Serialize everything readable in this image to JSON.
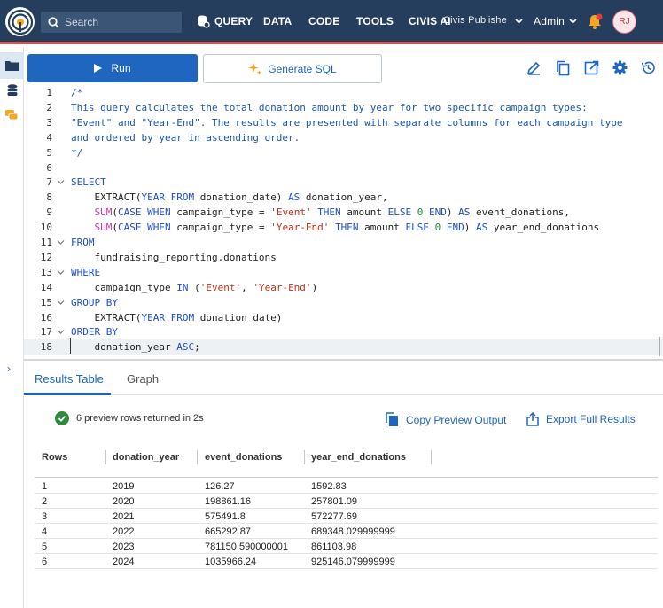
{
  "topbar": {
    "search_placeholder": "Search",
    "nav": [
      "QUERY",
      "DATA",
      "CODE",
      "TOOLS"
    ],
    "civis_ai": "CIVIS AI",
    "workspace": "Civis Publishe",
    "admin": "Admin",
    "avatar_initials": "RJ"
  },
  "toolbar": {
    "run_label": "Run",
    "generate_label": "Generate SQL"
  },
  "editor": {
    "lines": [
      {
        "n": "1",
        "fold": "",
        "tokens": [
          [
            "c-com",
            "/*"
          ]
        ]
      },
      {
        "n": "2",
        "fold": "",
        "tokens": [
          [
            "c-com",
            "This query calculates the total donation amount by year for two specific campaign types:"
          ]
        ]
      },
      {
        "n": "3",
        "fold": "",
        "tokens": [
          [
            "c-com",
            "\"Event\" and \"Year-End\". The results are presented with separate columns for each campaign type"
          ]
        ]
      },
      {
        "n": "4",
        "fold": "",
        "tokens": [
          [
            "c-com",
            "and ordered by year in ascending order."
          ]
        ]
      },
      {
        "n": "5",
        "fold": "",
        "tokens": [
          [
            "c-com",
            "*/"
          ]
        ]
      },
      {
        "n": "6",
        "fold": "",
        "tokens": []
      },
      {
        "n": "7",
        "fold": "v",
        "tokens": [
          [
            "c-kw",
            "SELECT"
          ]
        ]
      },
      {
        "n": "8",
        "fold": "",
        "tokens": [
          [
            "c-id",
            "    EXTRACT("
          ],
          [
            "c-kw",
            "YEAR FROM"
          ],
          [
            "c-id",
            " donation_date) "
          ],
          [
            "c-kw",
            "AS"
          ],
          [
            "c-id",
            " donation_year,"
          ]
        ]
      },
      {
        "n": "9",
        "fold": "",
        "tokens": [
          [
            "c-id",
            "    "
          ],
          [
            "c-fn",
            "SUM"
          ],
          [
            "c-id",
            "("
          ],
          [
            "c-kw",
            "CASE WHEN"
          ],
          [
            "c-id",
            " campaign_type = "
          ],
          [
            "c-str",
            "'Event'"
          ],
          [
            "c-id",
            " "
          ],
          [
            "c-kw",
            "THEN"
          ],
          [
            "c-id",
            " amount "
          ],
          [
            "c-kw",
            "ELSE"
          ],
          [
            "c-id",
            " "
          ],
          [
            "c-num",
            "0"
          ],
          [
            "c-id",
            " "
          ],
          [
            "c-kw",
            "END"
          ],
          [
            "c-id",
            ") "
          ],
          [
            "c-kw",
            "AS"
          ],
          [
            "c-id",
            " event_donations,"
          ]
        ]
      },
      {
        "n": "10",
        "fold": "",
        "tokens": [
          [
            "c-id",
            "    "
          ],
          [
            "c-fn",
            "SUM"
          ],
          [
            "c-id",
            "("
          ],
          [
            "c-kw",
            "CASE WHEN"
          ],
          [
            "c-id",
            " campaign_type = "
          ],
          [
            "c-str",
            "'Year-End'"
          ],
          [
            "c-id",
            " "
          ],
          [
            "c-kw",
            "THEN"
          ],
          [
            "c-id",
            " amount "
          ],
          [
            "c-kw",
            "ELSE"
          ],
          [
            "c-id",
            " "
          ],
          [
            "c-num",
            "0"
          ],
          [
            "c-id",
            " "
          ],
          [
            "c-kw",
            "END"
          ],
          [
            "c-id",
            ") "
          ],
          [
            "c-kw",
            "AS"
          ],
          [
            "c-id",
            " year_end_donations"
          ]
        ]
      },
      {
        "n": "11",
        "fold": "v",
        "tokens": [
          [
            "c-kw",
            "FROM"
          ]
        ]
      },
      {
        "n": "12",
        "fold": "",
        "tokens": [
          [
            "c-id",
            "    fundraising_reporting.donations"
          ]
        ]
      },
      {
        "n": "13",
        "fold": "v",
        "tokens": [
          [
            "c-kw",
            "WHERE"
          ]
        ]
      },
      {
        "n": "14",
        "fold": "",
        "tokens": [
          [
            "c-id",
            "    campaign_type "
          ],
          [
            "c-kw",
            "IN"
          ],
          [
            "c-id",
            " ("
          ],
          [
            "c-str",
            "'Event'"
          ],
          [
            "c-id",
            ", "
          ],
          [
            "c-str",
            "'Year-End'"
          ],
          [
            "c-id",
            ")"
          ]
        ]
      },
      {
        "n": "15",
        "fold": "v",
        "tokens": [
          [
            "c-kw",
            "GROUP BY"
          ]
        ]
      },
      {
        "n": "16",
        "fold": "",
        "tokens": [
          [
            "c-id",
            "    EXTRACT("
          ],
          [
            "c-kw",
            "YEAR FROM"
          ],
          [
            "c-id",
            " donation_date)"
          ]
        ]
      },
      {
        "n": "17",
        "fold": "v",
        "tokens": [
          [
            "c-kw",
            "ORDER BY"
          ]
        ]
      },
      {
        "n": "18",
        "fold": "",
        "tokens": [
          [
            "c-id",
            "    donation_year "
          ],
          [
            "c-kw",
            "ASC"
          ],
          [
            "c-id",
            ";"
          ]
        ]
      }
    ]
  },
  "results": {
    "tabs": [
      "Results Table",
      "Graph"
    ],
    "status": "6 preview rows returned in 2s",
    "copy_label": "Copy Preview Output",
    "export_label": "Export Full Results",
    "columns": [
      "Rows",
      "donation_year",
      "event_donations",
      "year_end_donations"
    ],
    "rows": [
      [
        "1",
        "2019",
        "126.27",
        "1592.83"
      ],
      [
        "2",
        "2020",
        "198861.16",
        "257801.09"
      ],
      [
        "3",
        "2021",
        "575491.8",
        "572277.69"
      ],
      [
        "4",
        "2022",
        "665292.87",
        "689348.029999999"
      ],
      [
        "5",
        "2023",
        "781150.590000001",
        "861103.98"
      ],
      [
        "6",
        "2024",
        "1035966.24",
        "925146.079999999"
      ]
    ]
  },
  "colors": {
    "topbar": "#253e5e",
    "accent": "#1f66c1",
    "alert": "#d9534f"
  }
}
